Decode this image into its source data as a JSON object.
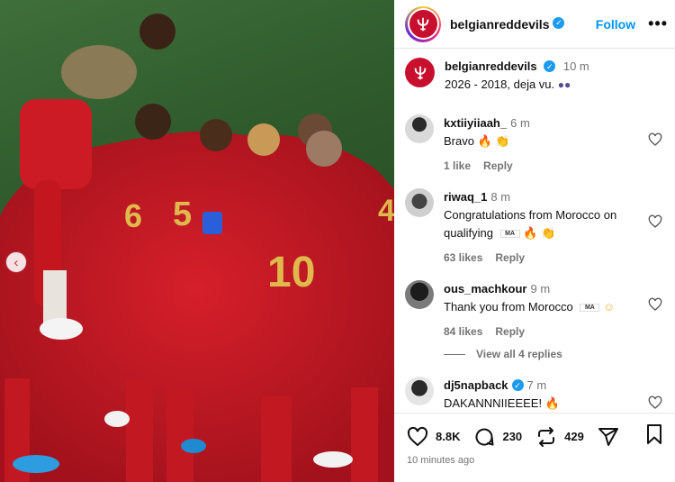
{
  "post": {
    "username": "belgianreddevils",
    "follow_label": "Follow",
    "more_label": "•••",
    "caption_text": "2026 - 2018, deja vu.",
    "caption_time": "10 m"
  },
  "comments": [
    {
      "user": "kxtiiyiiaah_",
      "time": "6 m",
      "text": "Bravo",
      "likes": "1 like",
      "reply": "Reply"
    },
    {
      "user": "riwaq_1",
      "time": "8 m",
      "text": "Congratulations from Morocco on qualifying",
      "flag": "MA",
      "likes": "63 likes",
      "reply": "Reply"
    },
    {
      "user": "ous_machkour",
      "time": "9 m",
      "text": "Thank you from Morocco",
      "flag": "MA",
      "likes": "84 likes",
      "reply": "Reply"
    },
    {
      "user": "dj5napback",
      "time": "7 m",
      "text": "DAKANNNIIEEEE!",
      "verified": true
    }
  ],
  "view_replies": "View all 4 replies",
  "stats": {
    "likes": "8.8K",
    "comments": "230",
    "reposts": "429"
  },
  "timestamp": "10 minutes ago",
  "colors": {
    "accent_blue": "#0095f6",
    "brand_red": "#c8102e",
    "verified_blue": "#1d9bf0",
    "muted": "#737373"
  }
}
